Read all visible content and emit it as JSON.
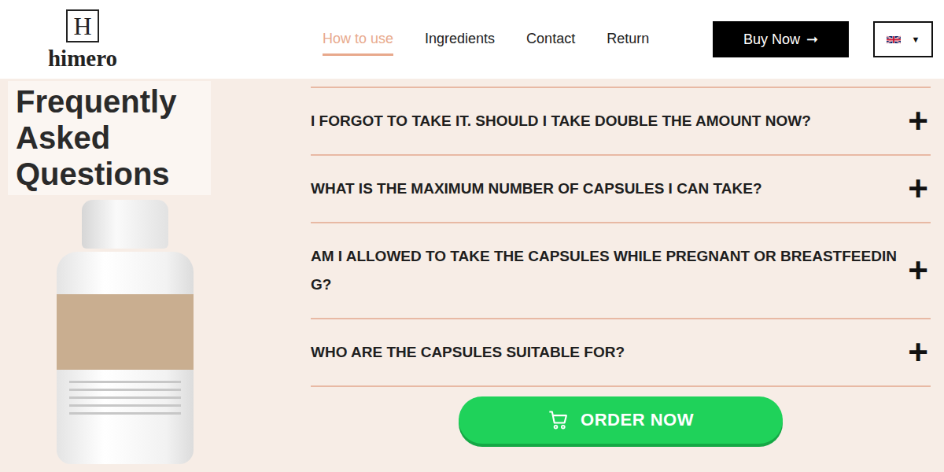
{
  "header": {
    "logo": {
      "letter": "H",
      "brand": "himero"
    },
    "nav": [
      {
        "label": "How to use",
        "selected": true
      },
      {
        "label": "Ingredients",
        "selected": false
      },
      {
        "label": "Contact",
        "selected": false
      },
      {
        "label": "Return",
        "selected": false
      }
    ],
    "buy_button": {
      "label": "Buy Now",
      "arrow": "➞"
    },
    "language": {
      "caret": "▼"
    }
  },
  "faq": {
    "title": "Frequently Asked Questions",
    "items": [
      {
        "question": "I FORGOT TO TAKE IT. SHOULD I TAKE DOUBLE THE AMOUNT NOW?",
        "toggle": "+",
        "expanded": false
      },
      {
        "question": "WHAT IS THE MAXIMUM NUMBER OF CAPSULES I CAN TAKE?",
        "toggle": "+",
        "expanded": false
      },
      {
        "question": "AM I ALLOWED TO TAKE THE CAPSULES WHILE PREGNANT OR BREASTFEEDING?",
        "toggle": "+",
        "expanded": false
      },
      {
        "question": "WHO ARE THE CAPSULES SUITABLE FOR?",
        "toggle": "+",
        "expanded": false
      }
    ]
  },
  "order_button": {
    "label": "ORDER NOW"
  }
}
